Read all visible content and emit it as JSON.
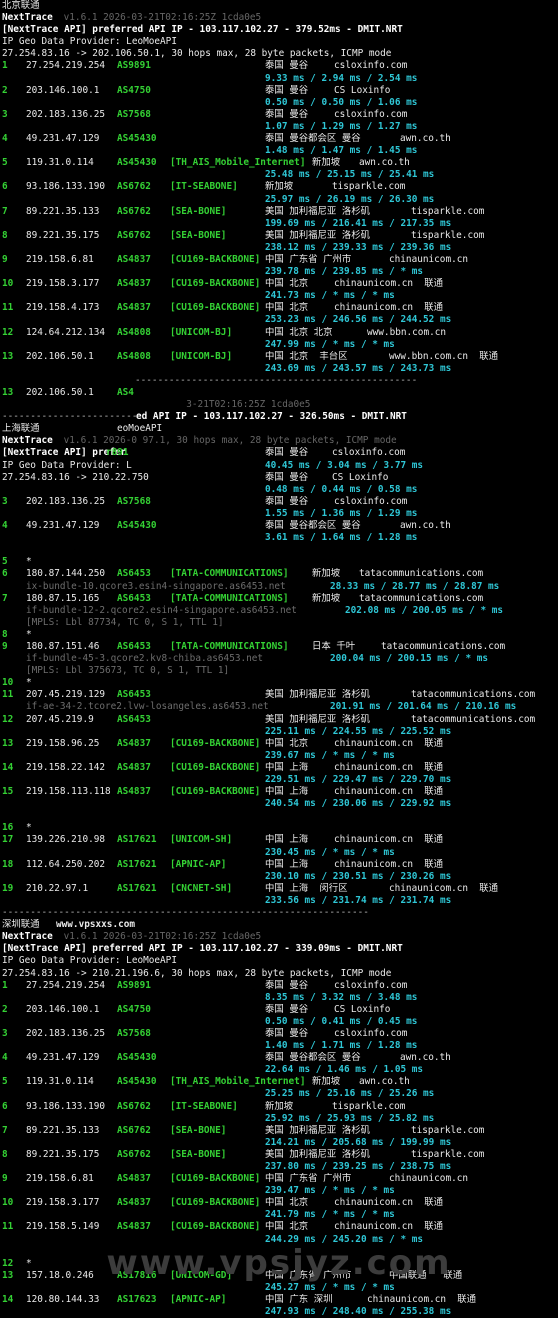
{
  "watermark": "www.vpsjyz.com",
  "lines": [
    {
      "kind": "plain",
      "text": "北京联通"
    },
    {
      "kind": "nt",
      "a": "NextTrace",
      "b": " v1.6.1 2026-03-21T02:16:25Z 1cda0e5"
    },
    {
      "kind": "api",
      "a": "[NextTrace API] preferred API IP - ",
      "b": "103.117.102.27",
      "c": " - ",
      "d": "379.52ms",
      "e": " - DMIT.NRT"
    },
    {
      "kind": "plain",
      "text": "IP Geo Data Provider: LeoMoeAPI"
    },
    {
      "kind": "plain",
      "text": "27.254.83.16 -> 202.106.50.1, 30 hops max, 28 byte packets, ICMP mode"
    },
    {
      "kind": "hop",
      "n": "1",
      "ip": "27.254.219.254",
      "asn": "AS9891",
      "tag": "",
      "geo": "泰国 曼谷",
      "host": "csloxinfo.com"
    },
    {
      "kind": "rtt",
      "text": "9.33 ms / 2.94 ms / 2.54 ms"
    },
    {
      "kind": "hop",
      "n": "2",
      "ip": "203.146.100.1",
      "asn": "AS4750",
      "tag": "",
      "geo": "泰国 曼谷",
      "host": "CS Loxinfo"
    },
    {
      "kind": "rtt",
      "text": "0.50 ms / 0.50 ms / 1.06 ms"
    },
    {
      "kind": "hop",
      "n": "3",
      "ip": "202.183.136.25",
      "asn": "AS7568",
      "tag": "",
      "geo": "泰国 曼谷",
      "host": "csloxinfo.com"
    },
    {
      "kind": "rtt",
      "text": "1.07 ms / 1.29 ms / 1.27 ms"
    },
    {
      "kind": "hop",
      "n": "4",
      "ip": "49.231.47.129",
      "asn": "AS45430",
      "tag": "",
      "geo": "泰国 曼谷都会区 曼谷",
      "host": "awn.co.th"
    },
    {
      "kind": "rtt",
      "text": "1.48 ms / 1.47 ms / 1.45 ms"
    },
    {
      "kind": "hop",
      "n": "5",
      "ip": "119.31.0.114",
      "asn": "AS45430",
      "tag": "[TH_AIS_Mobile_Internet]",
      "geo": "新加坡",
      "host": "awn.co.th"
    },
    {
      "kind": "rtt",
      "text": "25.48 ms / 25.15 ms / 25.41 ms"
    },
    {
      "kind": "hop",
      "n": "6",
      "ip": "93.186.133.190",
      "asn": "AS6762",
      "tag": "[IT-SEABONE]",
      "geo": "新加坡",
      "host": "tisparkle.com"
    },
    {
      "kind": "rtt",
      "text": "25.97 ms / 26.19 ms / 26.30 ms"
    },
    {
      "kind": "hop",
      "n": "7",
      "ip": "89.221.35.133",
      "asn": "AS6762",
      "tag": "[SEA-BONE]",
      "geo": "美国 加利福尼亚 洛杉矶",
      "host": "tisparkle.com"
    },
    {
      "kind": "rtt",
      "text": "199.69 ms / 216.41 ms / 217.35 ms"
    },
    {
      "kind": "hop",
      "n": "8",
      "ip": "89.221.35.175",
      "asn": "AS6762",
      "tag": "[SEA-BONE]",
      "geo": "美国 加利福尼亚 洛杉矶",
      "host": "tisparkle.com"
    },
    {
      "kind": "rtt",
      "text": "238.12 ms / 239.33 ms / 239.36 ms"
    },
    {
      "kind": "hop",
      "n": "9",
      "ip": "219.158.6.81",
      "asn": "AS4837",
      "tag": "[CU169-BACKBONE]",
      "geo": "中国 广东省 广州市",
      "host": "chinaunicom.cn"
    },
    {
      "kind": "rtt",
      "text": "239.78 ms / 239.85 ms / * ms"
    },
    {
      "kind": "hop",
      "n": "10",
      "ip": "219.158.3.177",
      "asn": "AS4837",
      "tag": "[CU169-BACKBONE]",
      "geo": "中国 北京",
      "host": "chinaunicom.cn  联通"
    },
    {
      "kind": "rtt",
      "text": "241.73 ms / * ms / * ms"
    },
    {
      "kind": "hop",
      "n": "11",
      "ip": "219.158.4.173",
      "asn": "AS4837",
      "tag": "[CU169-BACKBONE]",
      "geo": "中国 北京",
      "host": "chinaunicom.cn  联通"
    },
    {
      "kind": "rtt",
      "text": "253.23 ms / 246.56 ms / 244.52 ms"
    },
    {
      "kind": "hop",
      "n": "12",
      "ip": "124.64.212.134",
      "asn": "AS4808",
      "tag": "[UNICOM-BJ]",
      "geo": "中国 北京 北京",
      "host": "www.bbn.com.cn"
    },
    {
      "kind": "rtt",
      "text": "247.99 ms / * ms / * ms"
    },
    {
      "kind": "hop",
      "n": "13",
      "ip": "202.106.50.1",
      "asn": "AS4808",
      "tag": "[UNICOM-BJ]",
      "geo": "中国 北京  丰台区",
      "host": "www.bbn.com.cn  联通"
    },
    {
      "kind": "rtt",
      "text": "243.69 ms / 243.57 ms / 243.73 ms"
    },
    {
      "kind": "sepdash",
      "text": "--------------------------------------------------"
    },
    {
      "kind": "hopshort",
      "n": "13",
      "ip": "202.106.50.1",
      "asn": "AS4"
    },
    {
      "kind": "ghost",
      "text": "                                 3-21T02:16:25Z 1cda0e5"
    },
    {
      "kind": "ghost2",
      "a": "------------------------",
      "b": "ed API IP - ",
      "c": "103.117.102.27",
      "d": " - ",
      "e": "326.50ms",
      "f": " - DMIT.NRT"
    },
    {
      "kind": "plain2",
      "a": "上海联通",
      "b": "eoMoeAPI"
    },
    {
      "kind": "nt",
      "a": "NextTrace",
      "b": " v1.6.1 2026-0 97.1, 30 hops max, 28 byte packets, ICMP mode"
    },
    {
      "kind": "apishort",
      "a": "[NextTrace API] prefer",
      "b": "r891",
      "geo": "泰国 曼谷",
      "host": "csloxinfo.com"
    },
    {
      "kind": "mixed",
      "a": "IP Geo Data Provider: L",
      "rtt": "40.45 ms / 3.04 ms / 3.77 ms"
    },
    {
      "kind": "mixed2",
      "a": "27.254.83.16 -> 210.22.750",
      "geo": "泰国 曼谷",
      "host": "CS Loxinfo"
    },
    {
      "kind": "rtt",
      "text": "0.48 ms / 0.44 ms / 0.58 ms"
    },
    {
      "kind": "hop",
      "n": "3",
      "ip": "202.183.136.25",
      "asn": "AS7568",
      "tag": "",
      "geo": "泰国 曼谷",
      "host": "csloxinfo.com"
    },
    {
      "kind": "rtt",
      "text": "1.55 ms / 1.36 ms / 1.29 ms"
    },
    {
      "kind": "hop",
      "n": "4",
      "ip": "49.231.47.129",
      "asn": "AS45430",
      "tag": "",
      "geo": "泰国 曼谷都会区 曼谷",
      "host": "awn.co.th"
    },
    {
      "kind": "rtt",
      "text": "3.61 ms / 1.64 ms / 1.28 ms"
    },
    {
      "kind": "blank"
    },
    {
      "kind": "star",
      "n": "5"
    },
    {
      "kind": "hop",
      "n": "6",
      "ip": "180.87.144.250",
      "asn": "AS6453",
      "tag": "[TATA-COMMUNICATIONS]",
      "geo": "新加坡",
      "host": "tatacommunications.com"
    },
    {
      "kind": "sub",
      "a": "ix-bundle-10.qcore3.esin4-singapore.as6453.net",
      "rtt": "28.33 ms / 28.77 ms / 28.87 ms"
    },
    {
      "kind": "hop",
      "n": "7",
      "ip": "180.87.15.165",
      "asn": "AS6453",
      "tag": "[TATA-COMMUNICATIONS]",
      "geo": "新加坡",
      "host": "tatacommunications.com"
    },
    {
      "kind": "sub",
      "a": "if-bundle-12-2.qcore2.esin4-singapore.as6453.net",
      "rtt": "202.08 ms / 200.05 ms / * ms"
    },
    {
      "kind": "mpls",
      "text": "[MPLS: Lbl 87734, TC 0, S 1, TTL 1]"
    },
    {
      "kind": "star",
      "n": "8"
    },
    {
      "kind": "hop",
      "n": "9",
      "ip": "180.87.151.46",
      "asn": "AS6453",
      "tag": "[TATA-COMMUNICATIONS]",
      "geo": "日本 千叶",
      "host": "tatacommunications.com"
    },
    {
      "kind": "sub",
      "a": "if-bundle-45-3.qcore2.kv8-chiba.as6453.net",
      "rtt": "200.04 ms / 200.15 ms / * ms"
    },
    {
      "kind": "mpls",
      "text": "[MPLS: Lbl 375673, TC 0, S 1, TTL 1]"
    },
    {
      "kind": "star",
      "n": "10"
    },
    {
      "kind": "hop",
      "n": "11",
      "ip": "207.45.219.129",
      "asn": "AS6453",
      "tag": "",
      "geo": "美国 加利福尼亚 洛杉矶",
      "host": "tatacommunications.com"
    },
    {
      "kind": "sub",
      "a": "if-ae-34-2.tcore2.lvw-losangeles.as6453.net",
      "rtt": "201.91 ms / 201.64 ms / 210.16 ms"
    },
    {
      "kind": "hop",
      "n": "12",
      "ip": "207.45.219.9",
      "asn": "AS6453",
      "tag": "",
      "geo": "美国 加利福尼亚 洛杉矶",
      "host": "tatacommunications.com"
    },
    {
      "kind": "rtt",
      "text": "225.11 ms / 224.55 ms / 225.52 ms"
    },
    {
      "kind": "hop",
      "n": "13",
      "ip": "219.158.96.25",
      "asn": "AS4837",
      "tag": "[CU169-BACKBONE]",
      "geo": "中国 北京",
      "host": "chinaunicom.cn  联通"
    },
    {
      "kind": "rtt",
      "text": "239.67 ms / * ms / * ms"
    },
    {
      "kind": "hop",
      "n": "14",
      "ip": "219.158.22.142",
      "asn": "AS4837",
      "tag": "[CU169-BACKBONE]",
      "geo": "中国 上海",
      "host": "chinaunicom.cn  联通"
    },
    {
      "kind": "rtt",
      "text": "229.51 ms / 229.47 ms / 229.70 ms"
    },
    {
      "kind": "hop",
      "n": "15",
      "ip": "219.158.113.118",
      "asn": "AS4837",
      "tag": "[CU169-BACKBONE]",
      "geo": "中国 上海",
      "host": "chinaunicom.cn  联通"
    },
    {
      "kind": "rtt",
      "text": "240.54 ms / 230.06 ms / 229.92 ms"
    },
    {
      "kind": "blank"
    },
    {
      "kind": "star",
      "n": "16"
    },
    {
      "kind": "hop",
      "n": "17",
      "ip": "139.226.210.98",
      "asn": "AS17621",
      "tag": "[UNICOM-SH]",
      "geo": "中国 上海",
      "host": "chinaunicom.cn  联通"
    },
    {
      "kind": "rtt",
      "text": "230.45 ms / * ms / * ms"
    },
    {
      "kind": "hop",
      "n": "18",
      "ip": "112.64.250.202",
      "asn": "AS17621",
      "tag": "[APNIC-AP]",
      "geo": "中国 上海",
      "host": "chinaunicom.cn  联通"
    },
    {
      "kind": "rtt",
      "text": "230.10 ms / 230.51 ms / 230.26 ms"
    },
    {
      "kind": "hop",
      "n": "19",
      "ip": "210.22.97.1",
      "asn": "AS17621",
      "tag": "[CNCNET-SH]",
      "geo": "中国 上海  闵行区",
      "host": "chinaunicom.cn  联通"
    },
    {
      "kind": "rtt",
      "text": "233.56 ms / 231.74 ms / 231.74 ms"
    },
    {
      "kind": "sepdash2",
      "text": "-----------------------------------------------------------------"
    },
    {
      "kind": "plainsite",
      "a": "深圳联通",
      "b": "www.vpsxxs.com"
    },
    {
      "kind": "nt",
      "a": "NextTrace",
      "b": " v1.6.1 2026-03-21T02:16:25Z 1cda0e5"
    },
    {
      "kind": "api",
      "a": "[NextTrace API] preferred API IP - ",
      "b": "103.117.102.27",
      "c": " - ",
      "d": "339.09ms",
      "e": " - DMIT.NRT"
    },
    {
      "kind": "plain",
      "text": "IP Geo Data Provider: LeoMoeAPI"
    },
    {
      "kind": "plain",
      "text": "27.254.83.16 -> 210.21.196.6, 30 hops max, 28 byte packets, ICMP mode"
    },
    {
      "kind": "hop",
      "n": "1",
      "ip": "27.254.219.254",
      "asn": "AS9891",
      "tag": "",
      "geo": "泰国 曼谷",
      "host": "csloxinfo.com"
    },
    {
      "kind": "rtt",
      "text": "8.35 ms / 3.32 ms / 3.48 ms"
    },
    {
      "kind": "hop",
      "n": "2",
      "ip": "203.146.100.1",
      "asn": "AS4750",
      "tag": "",
      "geo": "泰国 曼谷",
      "host": "CS Loxinfo"
    },
    {
      "kind": "rtt",
      "text": "0.50 ms / 0.41 ms / 0.45 ms"
    },
    {
      "kind": "hop",
      "n": "3",
      "ip": "202.183.136.25",
      "asn": "AS7568",
      "tag": "",
      "geo": "泰国 曼谷",
      "host": "csloxinfo.com"
    },
    {
      "kind": "rtt",
      "text": "1.40 ms / 1.71 ms / 1.28 ms"
    },
    {
      "kind": "hop",
      "n": "4",
      "ip": "49.231.47.129",
      "asn": "AS45430",
      "tag": "",
      "geo": "泰国 曼谷都会区 曼谷",
      "host": "awn.co.th"
    },
    {
      "kind": "rtt",
      "text": "22.64 ms / 1.46 ms / 1.05 ms"
    },
    {
      "kind": "hop",
      "n": "5",
      "ip": "119.31.0.114",
      "asn": "AS45430",
      "tag": "[TH_AIS_Mobile_Internet]",
      "geo": "新加坡",
      "host": "awn.co.th"
    },
    {
      "kind": "rtt",
      "text": "25.25 ms / 25.16 ms / 25.26 ms"
    },
    {
      "kind": "hop",
      "n": "6",
      "ip": "93.186.133.190",
      "asn": "AS6762",
      "tag": "[IT-SEABONE]",
      "geo": "新加坡",
      "host": "tisparkle.com"
    },
    {
      "kind": "rtt",
      "text": "25.92 ms / 25.93 ms / 25.82 ms"
    },
    {
      "kind": "hop",
      "n": "7",
      "ip": "89.221.35.133",
      "asn": "AS6762",
      "tag": "[SEA-BONE]",
      "geo": "美国 加利福尼亚 洛杉矶",
      "host": "tisparkle.com"
    },
    {
      "kind": "rtt",
      "text": "214.21 ms / 205.68 ms / 199.99 ms"
    },
    {
      "kind": "hop",
      "n": "8",
      "ip": "89.221.35.175",
      "asn": "AS6762",
      "tag": "[SEA-BONE]",
      "geo": "美国 加利福尼亚 洛杉矶",
      "host": "tisparkle.com"
    },
    {
      "kind": "rtt",
      "text": "237.80 ms / 239.25 ms / 238.75 ms"
    },
    {
      "kind": "hop",
      "n": "9",
      "ip": "219.158.6.81",
      "asn": "AS4837",
      "tag": "[CU169-BACKBONE]",
      "geo": "中国 广东省 广州市",
      "host": "chinaunicom.cn"
    },
    {
      "kind": "rtt",
      "text": "239.47 ms / * ms / * ms"
    },
    {
      "kind": "hop",
      "n": "10",
      "ip": "219.158.3.177",
      "asn": "AS4837",
      "tag": "[CU169-BACKBONE]",
      "geo": "中国 北京",
      "host": "chinaunicom.cn  联通"
    },
    {
      "kind": "rtt",
      "text": "241.79 ms / * ms / * ms"
    },
    {
      "kind": "hop",
      "n": "11",
      "ip": "219.158.5.149",
      "asn": "AS4837",
      "tag": "[CU169-BACKBONE]",
      "geo": "中国 北京",
      "host": "chinaunicom.cn  联通"
    },
    {
      "kind": "rtt",
      "text": "244.29 ms / 245.20 ms / * ms"
    },
    {
      "kind": "blank"
    },
    {
      "kind": "star",
      "n": "12"
    },
    {
      "kind": "hop",
      "n": "13",
      "ip": "157.18.0.246",
      "asn": "AS17816",
      "tag": "[UNICOM-GD]",
      "geo": "中国 广东省 广州市",
      "host": "中国联通   联通"
    },
    {
      "kind": "rtt",
      "text": "245.27 ms / * ms / * ms"
    },
    {
      "kind": "hop",
      "n": "14",
      "ip": "120.80.144.33",
      "asn": "AS17623",
      "tag": "[APNIC-AP]",
      "geo": "中国 广东 深圳",
      "host": "chinaunicom.cn  联通"
    },
    {
      "kind": "rtt",
      "text": "247.93 ms / 248.40 ms / 255.38 ms"
    }
  ]
}
